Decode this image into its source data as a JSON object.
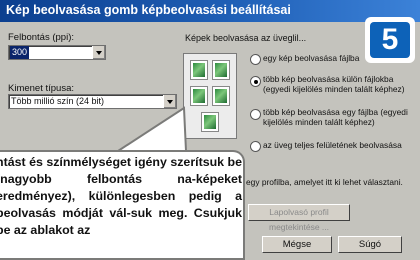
{
  "dialog": {
    "title": "Kép beolvasása gomb képbeolvasási beállításai",
    "step_number": "5"
  },
  "left": {
    "resolution_label": "Felbontás (ppi):",
    "resolution_value": "300",
    "output_label": "Kimenet típusa:",
    "output_value": "Több millió szín (24 bit)"
  },
  "right": {
    "heading": "Képek beolvasása az üveglil...",
    "options": [
      {
        "label": "egy kép beolvasása fájlba",
        "selected": false
      },
      {
        "label": "több kép beolvasása külön fájlokba (egyedi kijelölés minden talált képhez)",
        "selected": true
      },
      {
        "label": "több kép beolvasása egy fájlba (egyedi kijelölés minden talált képhez)",
        "selected": false
      },
      {
        "label": "az üveg teljes felületének beolvasása",
        "selected": false
      }
    ],
    "profile_note": "egy profilba, amelyet itt ki lehet választani.",
    "profile_button": "Lapolvasó profil megtekintése ..."
  },
  "buttons": {
    "cancel": "Mégse",
    "help": "Súgó"
  },
  "callout": {
    "text": "ntást és színmélységet igény szerítsuk be (nagyobb felbontás na-képeket eredményez), különlegesben pedig a beolvasás módját vál-suk meg. Csukjuk be az ablakot az"
  }
}
